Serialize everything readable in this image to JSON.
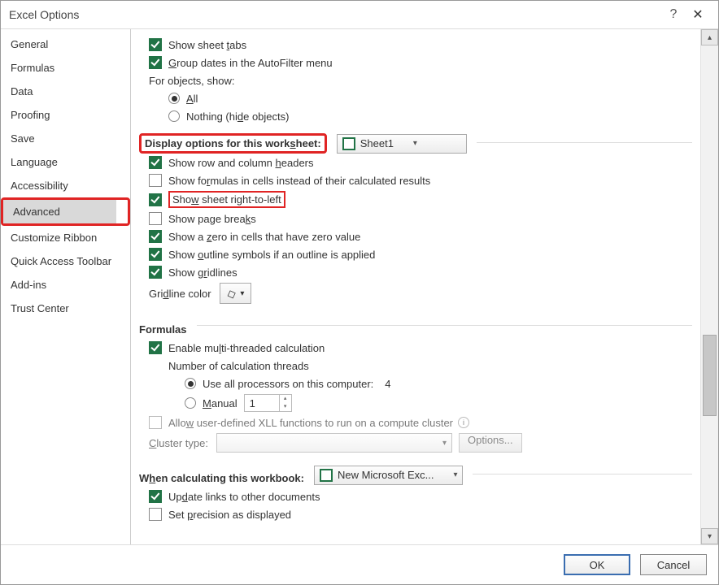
{
  "titlebar": {
    "title": "Excel Options"
  },
  "sidebar": {
    "items": [
      {
        "label": "General"
      },
      {
        "label": "Formulas"
      },
      {
        "label": "Data"
      },
      {
        "label": "Proofing"
      },
      {
        "label": "Save"
      },
      {
        "label": "Language"
      },
      {
        "label": "Accessibility"
      },
      {
        "label": "Advanced",
        "selected": true
      },
      {
        "label": "Customize Ribbon"
      },
      {
        "label": "Quick Access Toolbar"
      },
      {
        "label": "Add-ins"
      },
      {
        "label": "Trust Center"
      }
    ]
  },
  "top": {
    "show_sheet_tabs": "Show sheet tabs",
    "group_dates": "Group dates in the AutoFilter menu",
    "objects_label": "For objects, show:",
    "all": "All",
    "nothing": "Nothing (hide objects)"
  },
  "ws": {
    "header": "Display options for this worksheet:",
    "sheet": "Sheet1",
    "row_col_headers": "Show row and column headers",
    "formulas": "Show formulas in cells instead of their calculated results",
    "rtl": "Show sheet right-to-left",
    "page_breaks": "Show page breaks",
    "zero": "Show a zero in cells that have zero value",
    "outline": "Show outline symbols if an outline is applied",
    "gridlines": "Show gridlines",
    "gridline_color": "Gridline color"
  },
  "formulas": {
    "header": "Formulas",
    "multithread": "Enable multi-threaded calculation",
    "threads_label": "Number of calculation threads",
    "use_all": "Use all processors on this computer:",
    "use_all_value": "4",
    "manual": "Manual",
    "manual_value": "1",
    "xll": "Allow user-defined XLL functions to run on a compute cluster",
    "cluster_type": "Cluster type:",
    "options_btn": "Options..."
  },
  "calc": {
    "header": "When calculating this workbook:",
    "workbook": "New Microsoft Exc...",
    "update_links": "Update links to other documents",
    "precision": "Set precision as displayed"
  },
  "footer": {
    "ok": "OK",
    "cancel": "Cancel"
  }
}
